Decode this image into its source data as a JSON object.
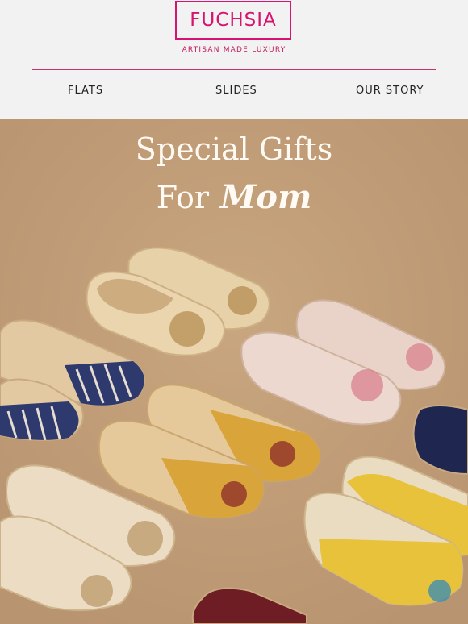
{
  "brand": {
    "logo": "FUCHSIA",
    "tagline": "ARTISAN MADE LUXURY",
    "accent_color": "#d6146f"
  },
  "nav": {
    "items": [
      "FLATS",
      "SLIDES",
      "OUR STORY"
    ]
  },
  "hero": {
    "title_line1": "Special Gifts",
    "title_for": "For",
    "title_mom": "Mom",
    "background_color": "#c4a07a",
    "image_label": "fuchsia"
  }
}
